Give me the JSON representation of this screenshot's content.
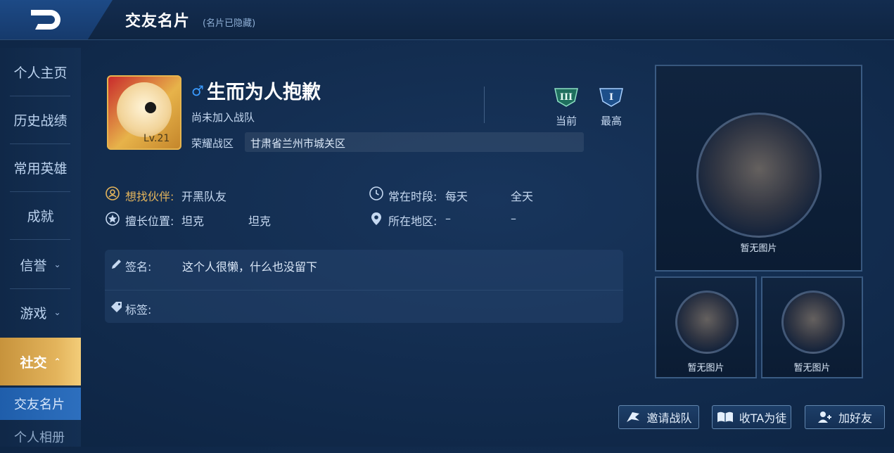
{
  "header": {
    "title": "交友名片",
    "subtitle": "(名片已隐藏)",
    "back_icon": "back-arrow-icon"
  },
  "sidebar": {
    "items": [
      {
        "label": "个人主页"
      },
      {
        "label": "历史战绩"
      },
      {
        "label": "常用英雄"
      },
      {
        "label": "成就"
      },
      {
        "label": "信誉",
        "chevron": "⌄"
      },
      {
        "label": "游戏",
        "chevron": "⌄"
      },
      {
        "label": "社交",
        "chevron": "⌃",
        "active": true
      }
    ],
    "subitems": [
      {
        "label": "交友名片",
        "active": true
      },
      {
        "label": "个人相册"
      }
    ]
  },
  "profile": {
    "level": "Lv.21",
    "gender_symbol": "♂",
    "name": "生而为人抱歉",
    "team_status": "尚未加入战队",
    "zone_label": "荣耀战区",
    "zone_value": "甘肃省兰州市城关区",
    "rank_current": {
      "icon": "III",
      "label": "当前"
    },
    "rank_highest": {
      "icon": "I",
      "label": "最高"
    }
  },
  "details": {
    "partner": {
      "label": "想找伙伴:",
      "value": "开黑队友"
    },
    "position": {
      "label": "擅长位置:",
      "value1": "坦克",
      "value2": "坦克"
    },
    "time": {
      "label": "常在时段:",
      "value1": "每天",
      "value2": "全天"
    },
    "region": {
      "label": "所在地区:",
      "value1": "–",
      "value2": "–"
    }
  },
  "signature": {
    "label": "签名:",
    "text": "这个人很懒，什么也没留下",
    "tag_label": "标签:"
  },
  "photos": {
    "main_text": "暂无图片",
    "small1_text": "暂无图片",
    "small2_text": "暂无图片"
  },
  "actions": {
    "invite": "邀请战队",
    "apprentice": "收TA为徒",
    "add_friend": "加好友"
  },
  "colors": {
    "accent_gold": "#e3b45c",
    "active_tab_blue": "#1f5eab",
    "male_blue": "#3a9bff"
  }
}
